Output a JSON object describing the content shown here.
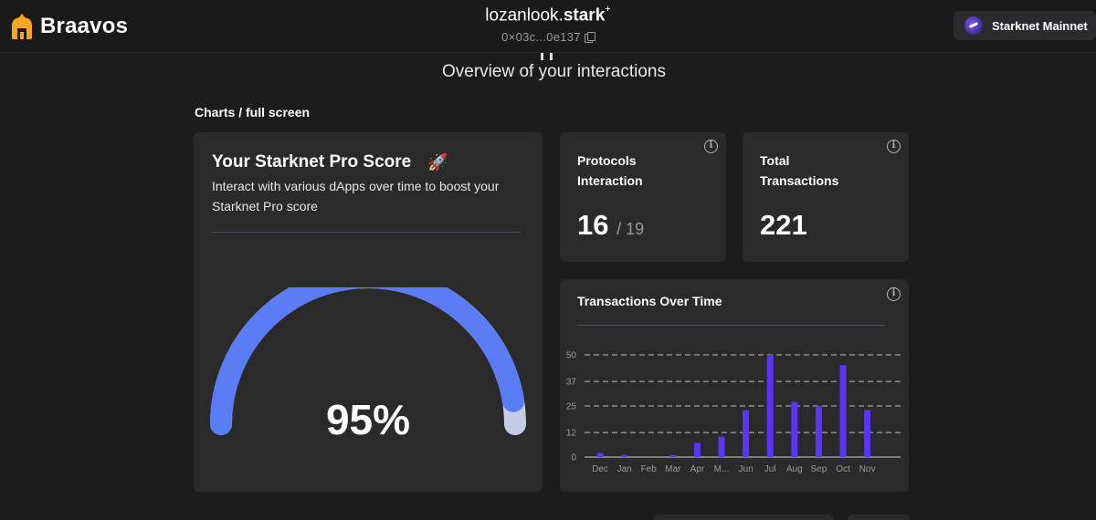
{
  "header": {
    "logo_text": "Braavos",
    "account_name_plain": "lozanlook.",
    "account_name_bold": "stark",
    "account_name_mark": "+",
    "account_address": "0×03c...0e137",
    "network_label": "Starknet Mainnet",
    "icons": [
      "braavos-logo-icon",
      "copy-icon",
      "starknet-network-icon"
    ]
  },
  "page": {
    "subtitle": "Overview of your interactions",
    "section_label": "Charts / full screen"
  },
  "score_card": {
    "title": "Your Starknet Pro Score",
    "emoji": "🚀",
    "description": "Interact with various dApps over time to boost your Starknet Pro score",
    "value_label": "95%",
    "value": 95,
    "colors": {
      "fill": "#5a7df6",
      "remainder": "#c8cbe6"
    }
  },
  "protocols_card": {
    "title_line1": "Protocols",
    "title_line2": "Interaction",
    "value": "16",
    "total": "/ 19",
    "info": "i"
  },
  "transactions_card": {
    "title_line1": "Total",
    "title_line2": "Transactions",
    "value": "221",
    "info": "i"
  },
  "chart_card": {
    "title": "Transactions Over Time",
    "info": "i"
  },
  "chart_data": {
    "type": "bar",
    "title": "Transactions Over Time",
    "categories": [
      "Dec",
      "Jan",
      "Feb",
      "Mar",
      "Apr",
      "M...",
      "Jun",
      "Jul",
      "Aug",
      "Sep",
      "Oct",
      "Nov"
    ],
    "values": [
      2,
      1,
      0,
      1,
      7,
      10,
      23,
      50,
      27,
      25,
      45,
      23
    ],
    "yticks": [
      "0",
      "12",
      "25",
      "37",
      "50"
    ],
    "ylim": [
      0,
      50
    ],
    "grid": true,
    "bar_color": "#5b35f5"
  }
}
